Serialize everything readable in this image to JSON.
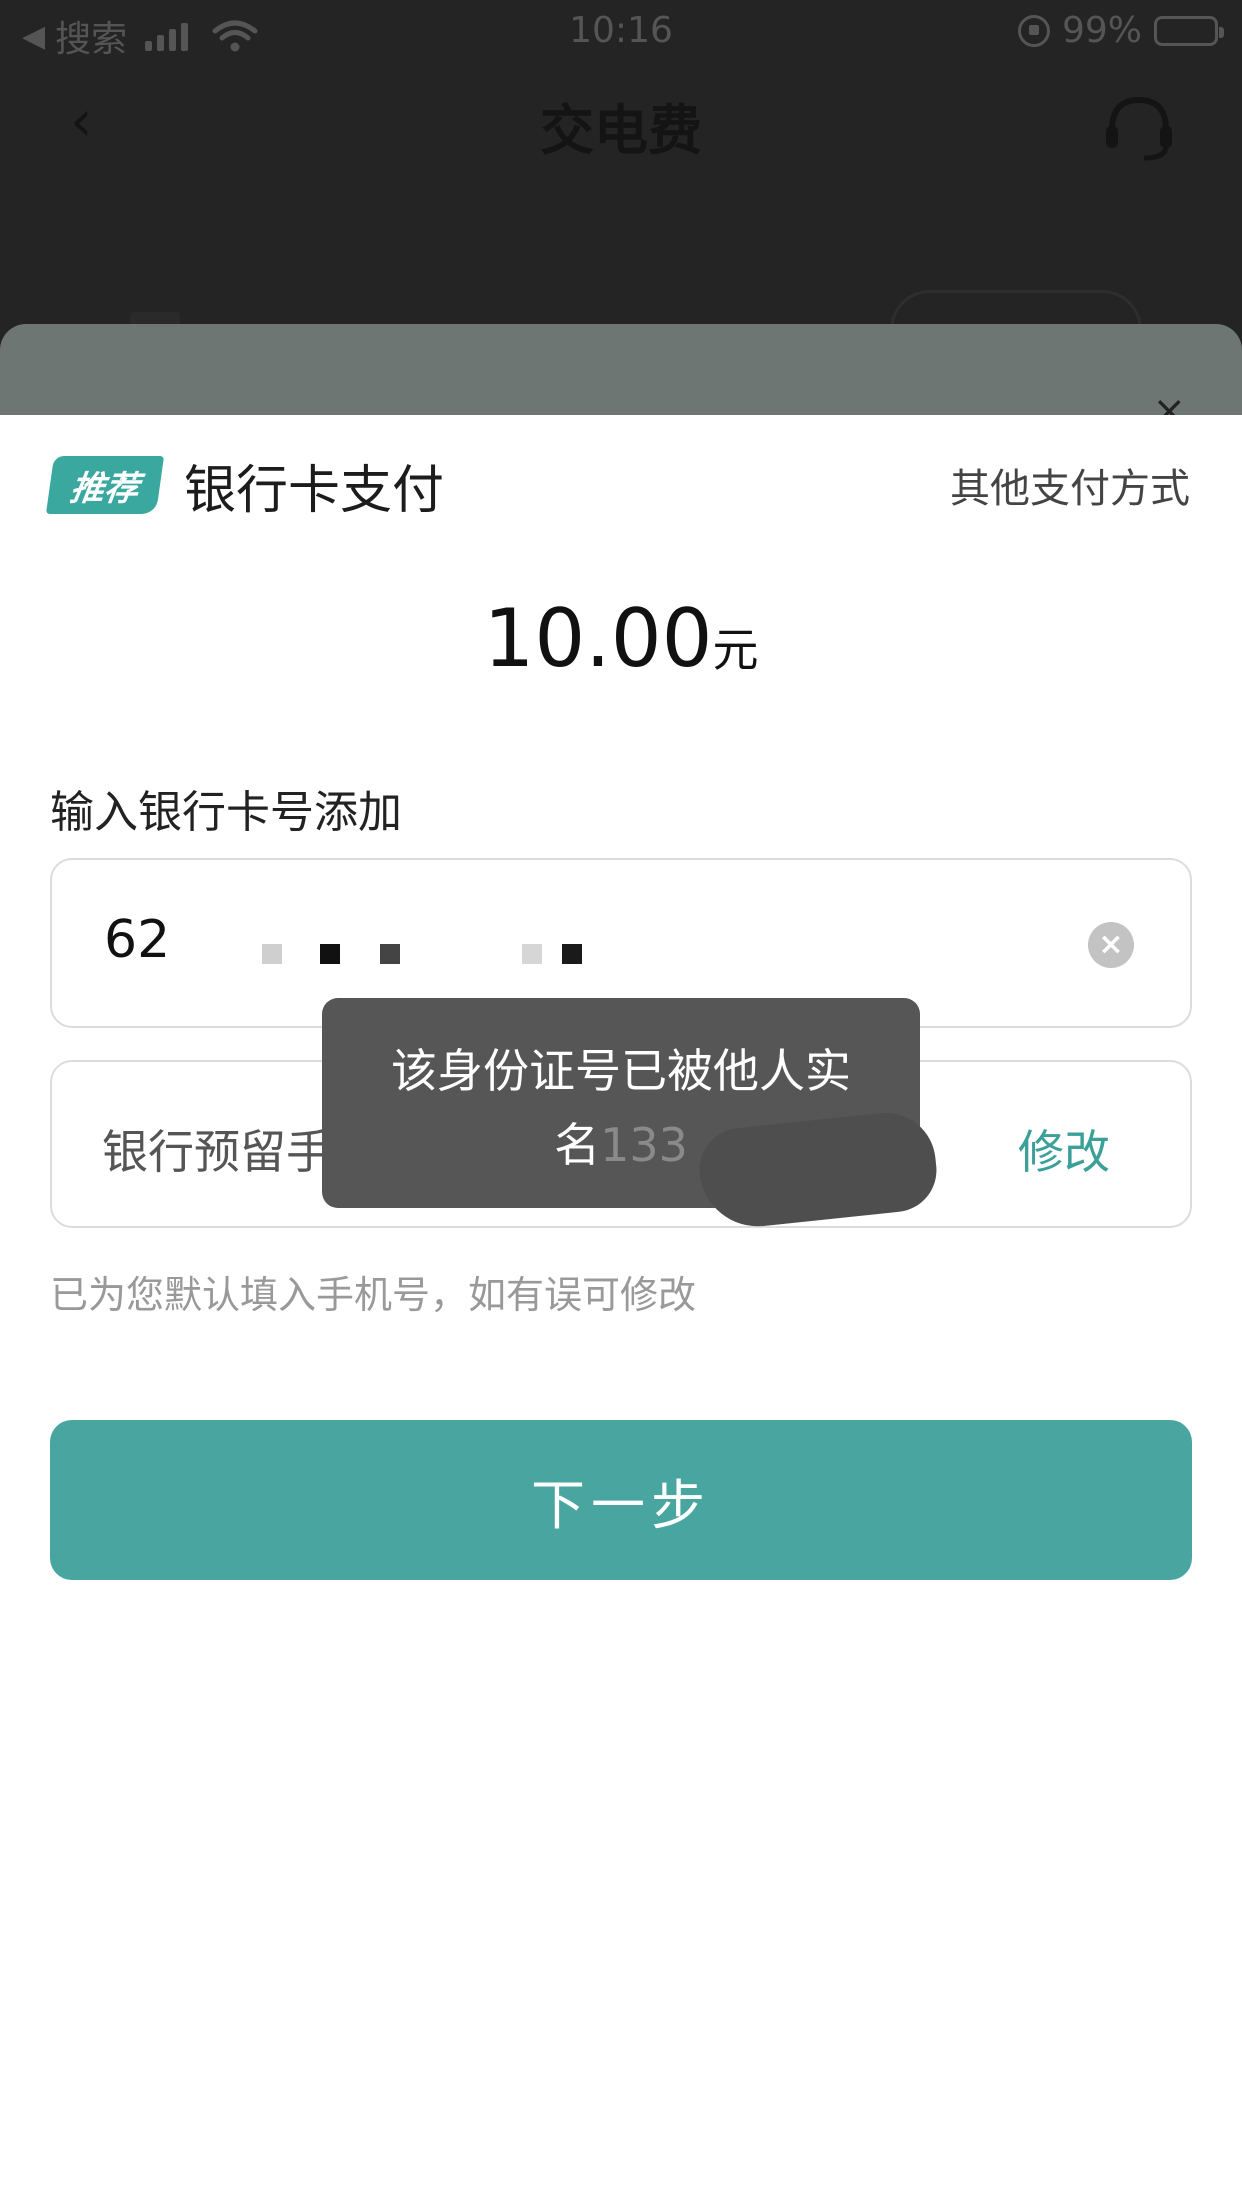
{
  "status_bar": {
    "back_app": "搜索",
    "time": "10:16",
    "battery": "99%"
  },
  "nav": {
    "title": "交电费"
  },
  "sheet": {
    "badge": "推荐",
    "method": "银行卡支付",
    "other_methods": "其他支付方式",
    "amount": "10.00",
    "amount_unit": "元",
    "card_label": "输入银行卡号添加",
    "card_number_visible": "62",
    "phone_label": "银行预留手机号",
    "modify": "修改",
    "hint": "已为您默认填入手机号，如有误可修改",
    "next": "下一步"
  },
  "toast": {
    "line1": "该身份证号已被他人实",
    "line2": "名",
    "line2_tail": "133"
  },
  "colors": {
    "accent": "#48a5a0",
    "badge": "#3aa89e",
    "toast_bg": "#565656"
  },
  "icons": [
    "back-arrow-icon",
    "signal-icon",
    "wifi-icon",
    "rotation-lock-icon",
    "battery-icon",
    "chevron-left-icon",
    "headset-icon",
    "close-icon",
    "clear-icon"
  ]
}
